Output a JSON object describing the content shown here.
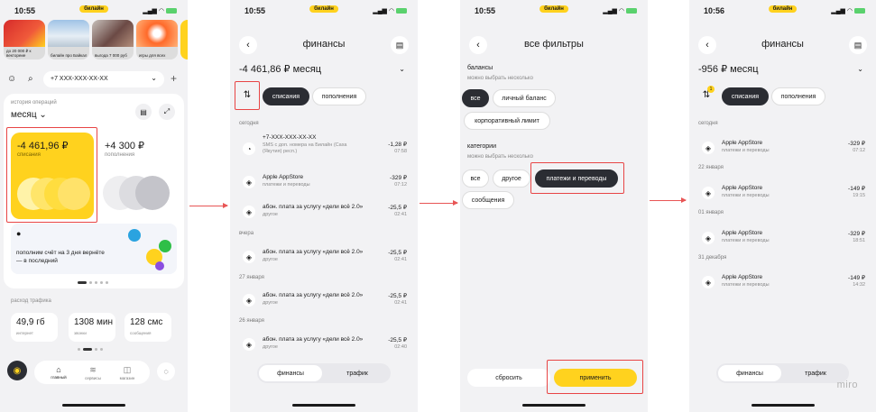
{
  "status": {
    "beeline": "билайн"
  },
  "screen1": {
    "time": "10:55",
    "stories": [
      {
        "caption": "до 20 000 ₽ к вектореие"
      },
      {
        "caption": "билайн про Байкал"
      },
      {
        "caption": "выгода 7 000 руб"
      },
      {
        "caption": "игры для всех"
      }
    ],
    "search_text": "+7 XXX-XXX-XX-XX",
    "history_label": "история операций",
    "period": "месяц",
    "spend_amount": "-4 461,96 ₽",
    "spend_label": "списания",
    "topup_amount": "+4 300 ₽",
    "topup_label": "пополнения",
    "promo_text": "пополним счёт на 3 дня вернёте — в последний",
    "traffic_label": "расход трафика",
    "stats": [
      {
        "value": "49,9 гб",
        "label": "интернет"
      },
      {
        "value": "1308 мин",
        "label": "звонки"
      },
      {
        "value": "128 смс",
        "label": "сообщения"
      }
    ],
    "tabs": [
      {
        "label": "главный"
      },
      {
        "label": "сервисы"
      },
      {
        "label": "магазин"
      }
    ]
  },
  "screen2": {
    "time": "10:55",
    "title": "финансы",
    "amount": "-4 461,86 ₽ месяц",
    "chip_debit": "списания",
    "chip_credit": "пополнения",
    "sections": {
      "today": "сегодня",
      "yesterday": "вчера",
      "jan27": "27 января",
      "jan26": "26 января"
    },
    "tx": [
      {
        "t1": "+7-XXX-XXX-XX-XX",
        "t2": "SMS с доп. номера на Билайн (Саха (Якутия) респ.)",
        "a1": "-1,28 ₽",
        "a2": "07:58"
      },
      {
        "t1": "Apple AppStore",
        "t2": "платежи и переводы",
        "a1": "-329 ₽",
        "a2": "07:12"
      },
      {
        "t1": "абон. плата за услугу «дели всё 2.0»",
        "t2": "другое",
        "a1": "-25,5 ₽",
        "a2": "02:41"
      },
      {
        "t1": "абон. плата за услугу «дели всё 2.0»",
        "t2": "другое",
        "a1": "-25,5 ₽",
        "a2": "02:41"
      },
      {
        "t1": "абон. плата за услугу «дели всё 2.0»",
        "t2": "другое",
        "a1": "-25,5 ₽",
        "a2": "02:41"
      },
      {
        "t1": "абон. плата за услугу «дели всё 2.0»",
        "t2": "другое",
        "a1": "-25,5 ₽",
        "a2": "02:40"
      }
    ],
    "seg_finance": "финансы",
    "seg_traffic": "трафик"
  },
  "screen3": {
    "time": "10:55",
    "title": "все фильтры",
    "balances_label": "балансы",
    "balances_hint": "можно выбрать несколько",
    "balances": {
      "all": "все",
      "personal": "личный баланс",
      "corporate": "корпоративный лимит"
    },
    "categories_label": "категории",
    "categories_hint": "можно выбрать несколько",
    "categories": {
      "all": "все",
      "other": "другое",
      "payments": "платежи и переводы",
      "messages": "сообщения"
    },
    "reset": "сбросить",
    "apply": "применить"
  },
  "screen4": {
    "time": "10:56",
    "title": "финансы",
    "amount": "-956 ₽ месяц",
    "filter_count": "1",
    "chip_debit": "списания",
    "chip_credit": "пополнения",
    "sections": {
      "today": "сегодня",
      "jan22": "22 января",
      "jan01": "01 января",
      "dec31": "31 декабря"
    },
    "tx": [
      {
        "t1": "Apple AppStore",
        "t2": "платежи и переводы",
        "a1": "-329 ₽",
        "a2": "07:12"
      },
      {
        "t1": "Apple AppStore",
        "t2": "платежи и переводы",
        "a1": "-149 ₽",
        "a2": "19:15"
      },
      {
        "t1": "Apple AppStore",
        "t2": "платежи и переводы",
        "a1": "-329 ₽",
        "a2": "18:51"
      },
      {
        "t1": "Apple AppStore",
        "t2": "платежи и переводы",
        "a1": "-149 ₽",
        "a2": "14:32"
      }
    ],
    "seg_finance": "финансы",
    "seg_traffic": "трафик"
  },
  "watermark": "miro",
  "colors": {
    "yellow": "#ffd21e",
    "dark": "#2b2d33",
    "highlight": "#e84545",
    "background": "#f2f2f4"
  }
}
